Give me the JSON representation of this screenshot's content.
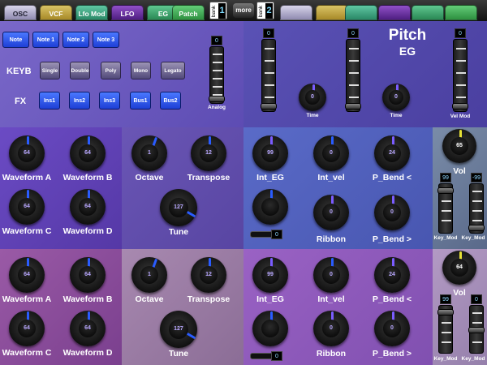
{
  "colors": {
    "osc": "#b4b0d0",
    "vcf": "#b8a13e",
    "lfomod": "#3a9e7c",
    "lfo": "#6a2ca0",
    "eg": "#3a9e6c",
    "patch": "#3ea55a",
    "knob_blue": "#2a5cff",
    "knob_yellow": "#e5e035",
    "purple": "#6a4fc4"
  },
  "tabs": [
    {
      "label": "OSC",
      "active": true
    },
    {
      "label": "VCF"
    },
    {
      "label": "Lfo Mod"
    },
    {
      "label": "LFO"
    },
    {
      "label": "EG"
    },
    {
      "label": "Patch"
    }
  ],
  "bank1": {
    "label": "bank",
    "number": "1"
  },
  "bank2": {
    "label": "bank",
    "number": "2"
  },
  "more": "more",
  "notes": [
    "Note",
    "Note 1",
    "Note 2",
    "Note 3"
  ],
  "keyb": {
    "label": "KEYB",
    "buttons": [
      "Single",
      "Double",
      "Poly",
      "Mono",
      "Legato"
    ]
  },
  "fx": {
    "label": "FX",
    "buttons": [
      "Ins1",
      "Ins2",
      "Ins3",
      "Bus1",
      "Bus2"
    ]
  },
  "analog": {
    "label": "Analog",
    "value": "0"
  },
  "pitch_eg": {
    "title": "Pitch",
    "subtitle": "EG",
    "slider_values": [
      "0",
      "0",
      "0"
    ],
    "time_labels": [
      "Time",
      "Time"
    ],
    "time_values": [
      "0",
      "0"
    ],
    "velmod_label": "Vel Mod",
    "velmod_value": "0"
  },
  "upper": {
    "wave": {
      "labels": [
        "Waveform A",
        "Waveform B",
        "Waveform C",
        "Waveform D"
      ],
      "values": [
        "64",
        "64",
        "64",
        "64"
      ]
    },
    "octave": {
      "label": "Octave",
      "value": "1"
    },
    "transpose": {
      "label": "Transpose",
      "value": "12"
    },
    "tune": {
      "label": "Tune",
      "value": "127"
    },
    "int_eg": {
      "label": "Int_EG",
      "value": "99"
    },
    "int_vel": {
      "label": "Int_vel",
      "value": "0"
    },
    "pbend_up": {
      "label": "P_Bend <",
      "value": "24"
    },
    "pbend_dn": {
      "label": "P_Bend >",
      "value": "0"
    },
    "ribbon": {
      "label": "Ribbon",
      "value": "0"
    },
    "fader_value": "0",
    "vol": {
      "label": "Vol",
      "value": "65"
    },
    "keymod": {
      "labels": [
        "Key_Mod",
        "Key_Mod"
      ],
      "values": [
        "99",
        "-99"
      ]
    }
  },
  "lower": {
    "wave": {
      "labels": [
        "Waveform A",
        "Waveform B",
        "Waveform C",
        "Waveform D"
      ],
      "values": [
        "64",
        "64",
        "64",
        "64"
      ]
    },
    "octave": {
      "label": "Octave",
      "value": "1"
    },
    "transpose": {
      "label": "Transpose",
      "value": "12"
    },
    "tune": {
      "label": "Tune",
      "value": "127"
    },
    "int_eg": {
      "label": "Int_EG",
      "value": "99"
    },
    "int_vel": {
      "label": "Int_vel",
      "value": "0"
    },
    "pbend_up": {
      "label": "P_Bend <",
      "value": "24"
    },
    "pbend_dn": {
      "label": "P_Bend >",
      "value": "0"
    },
    "ribbon": {
      "label": "Ribbon",
      "value": "0"
    },
    "fader_value": "0",
    "vol": {
      "label": "Vol",
      "value": "64"
    },
    "keymod": {
      "labels": [
        "Key_Mod",
        "Key_Mod"
      ],
      "values": [
        "99",
        "0"
      ]
    }
  }
}
